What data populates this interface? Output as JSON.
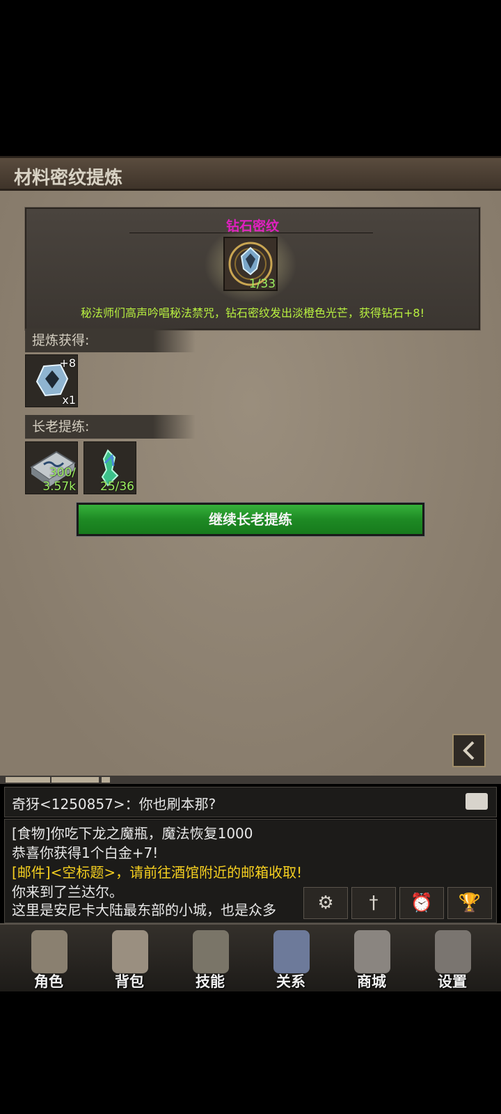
{
  "title": "材料密纹提炼",
  "rune": {
    "name": "钻石密纹",
    "count": "1/33",
    "description": "秘法师们高声吟唱秘法禁咒，钻石密纹发出淡橙色光芒，获得钻石+8!"
  },
  "refine_gain": {
    "label": "提炼获得:",
    "item": {
      "icon": "diamond-icon",
      "bonus": "+8",
      "qty": "x1"
    }
  },
  "elder_refine": {
    "label": "长老提练:",
    "items": [
      {
        "icon": "rune-tablet-icon",
        "count_line1": "300/",
        "count_line2": "3.57k"
      },
      {
        "icon": "green-crystal-icon",
        "count_line1": "",
        "count_line2": "25/36"
      }
    ]
  },
  "continue_button": "继续长老提练",
  "chat": {
    "input_text": "奇犽<1250857>：你也刷本那?",
    "log": [
      {
        "text": "[食物]你吃下龙之魔瓶，魔法恢复1000",
        "color": "#e8e8e8"
      },
      {
        "text": "恭喜你获得1个白金+7!",
        "color": "#e8e8e8"
      },
      {
        "text": "[邮件]<空标题>，请前往酒馆附近的邮箱收取!",
        "color": "#f6d020"
      },
      {
        "text": "你来到了兰达尔。",
        "color": "#e8e8e8"
      },
      {
        "text": "这里是安尼卡大陆最东部的小城，也是众多",
        "color": "#e8e8e8"
      }
    ]
  },
  "quick_icons": [
    "compass-gear-icon",
    "sword-icon",
    "alarm-clock-icon",
    "trophy-icon"
  ],
  "nav": [
    {
      "label": "角色",
      "icon": "helmet-icon",
      "color": "#8a8070"
    },
    {
      "label": "背包",
      "icon": "backpack-icon",
      "color": "#9a8f80"
    },
    {
      "label": "技能",
      "icon": "spellbook-icon",
      "color": "#7a7568"
    },
    {
      "label": "关系",
      "icon": "handshake-icon",
      "color": "#6d7a9a"
    },
    {
      "label": "商城",
      "icon": "chest-icon",
      "color": "#8a8580"
    },
    {
      "label": "设置",
      "icon": "gear-icon",
      "color": "#7a7570"
    }
  ]
}
